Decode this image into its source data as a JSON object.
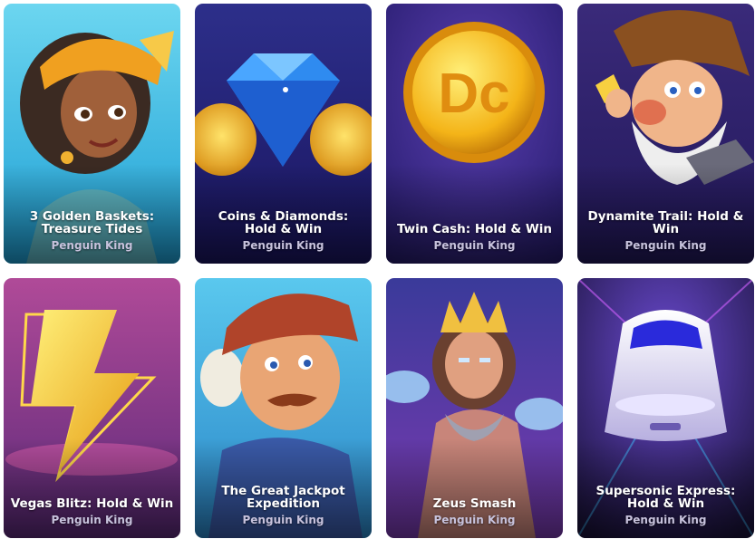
{
  "games": [
    {
      "title": "3 Golden Baskets: Treasure Tides",
      "provider": "Penguin King",
      "artwork": "girl-with-headscarf"
    },
    {
      "title": "Coins & Diamonds: Hold & Win",
      "provider": "Penguin King",
      "artwork": "blue-diamond-with-coins"
    },
    {
      "title": "Twin Cash: Hold & Win",
      "provider": "Penguin King",
      "artwork": "gold-dc-coin"
    },
    {
      "title": "Dynamite Trail: Hold & Win",
      "provider": "Penguin King",
      "artwork": "old-prospector"
    },
    {
      "title": "Vegas Blitz: Hold & Win",
      "provider": "Penguin King",
      "artwork": "golden-lightning-bolt"
    },
    {
      "title": "The Great Jackpot Expedition",
      "provider": "Penguin King",
      "artwork": "captain-in-tricorn-hat"
    },
    {
      "title": "Zeus Smash",
      "provider": "Penguin King",
      "artwork": "zeus-with-crown"
    },
    {
      "title": "Supersonic Express: Hold & Win",
      "provider": "Penguin King",
      "artwork": "bullet-train"
    }
  ]
}
